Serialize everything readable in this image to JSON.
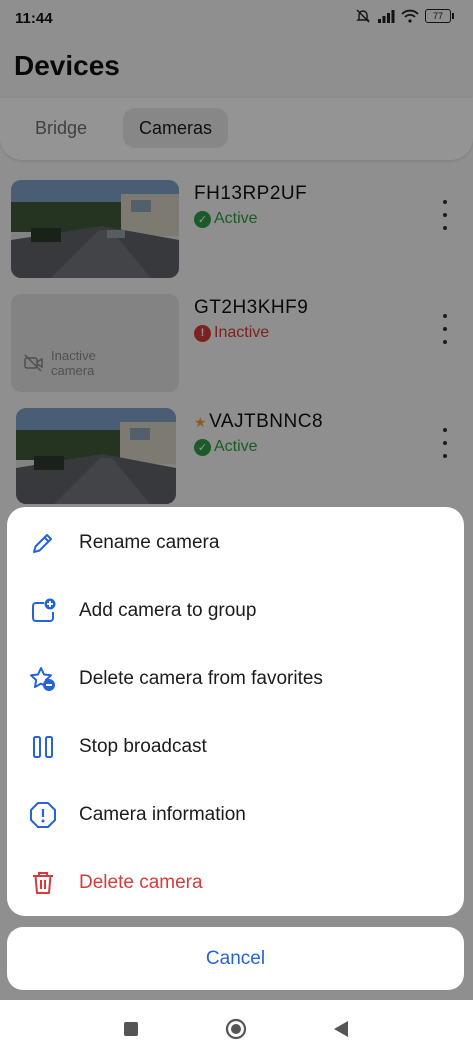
{
  "status_bar": {
    "time": "11:44",
    "battery": "77"
  },
  "header": {
    "title": "Devices"
  },
  "tabs": [
    {
      "label": "Bridge",
      "selected": false
    },
    {
      "label": "Cameras",
      "selected": true
    }
  ],
  "cameras": [
    {
      "name": "FH13RP2UF",
      "status": "Active",
      "favorite": false
    },
    {
      "name": "GT2H3KHF9",
      "status": "Inactive",
      "favorite": false,
      "placeholder_line1": "Inactive",
      "placeholder_line2": "camera"
    },
    {
      "name": "VAJTBNNC8",
      "status": "Active",
      "favorite": true
    }
  ],
  "action_sheet": {
    "items": [
      {
        "label": "Rename camera",
        "icon": "pencil-icon"
      },
      {
        "label": "Add camera to group",
        "icon": "folder-add-icon"
      },
      {
        "label": "Delete camera from favorites",
        "icon": "star-remove-icon"
      },
      {
        "label": "Stop broadcast",
        "icon": "pause-icon"
      },
      {
        "label": "Camera information",
        "icon": "info-octagon-icon"
      },
      {
        "label": "Delete camera",
        "icon": "trash-icon"
      }
    ],
    "cancel_label": "Cancel"
  },
  "colors": {
    "accent": "#2563d8",
    "active": "#2e9e44",
    "danger": "#d83a3a",
    "favorite": "#e8a33a"
  }
}
